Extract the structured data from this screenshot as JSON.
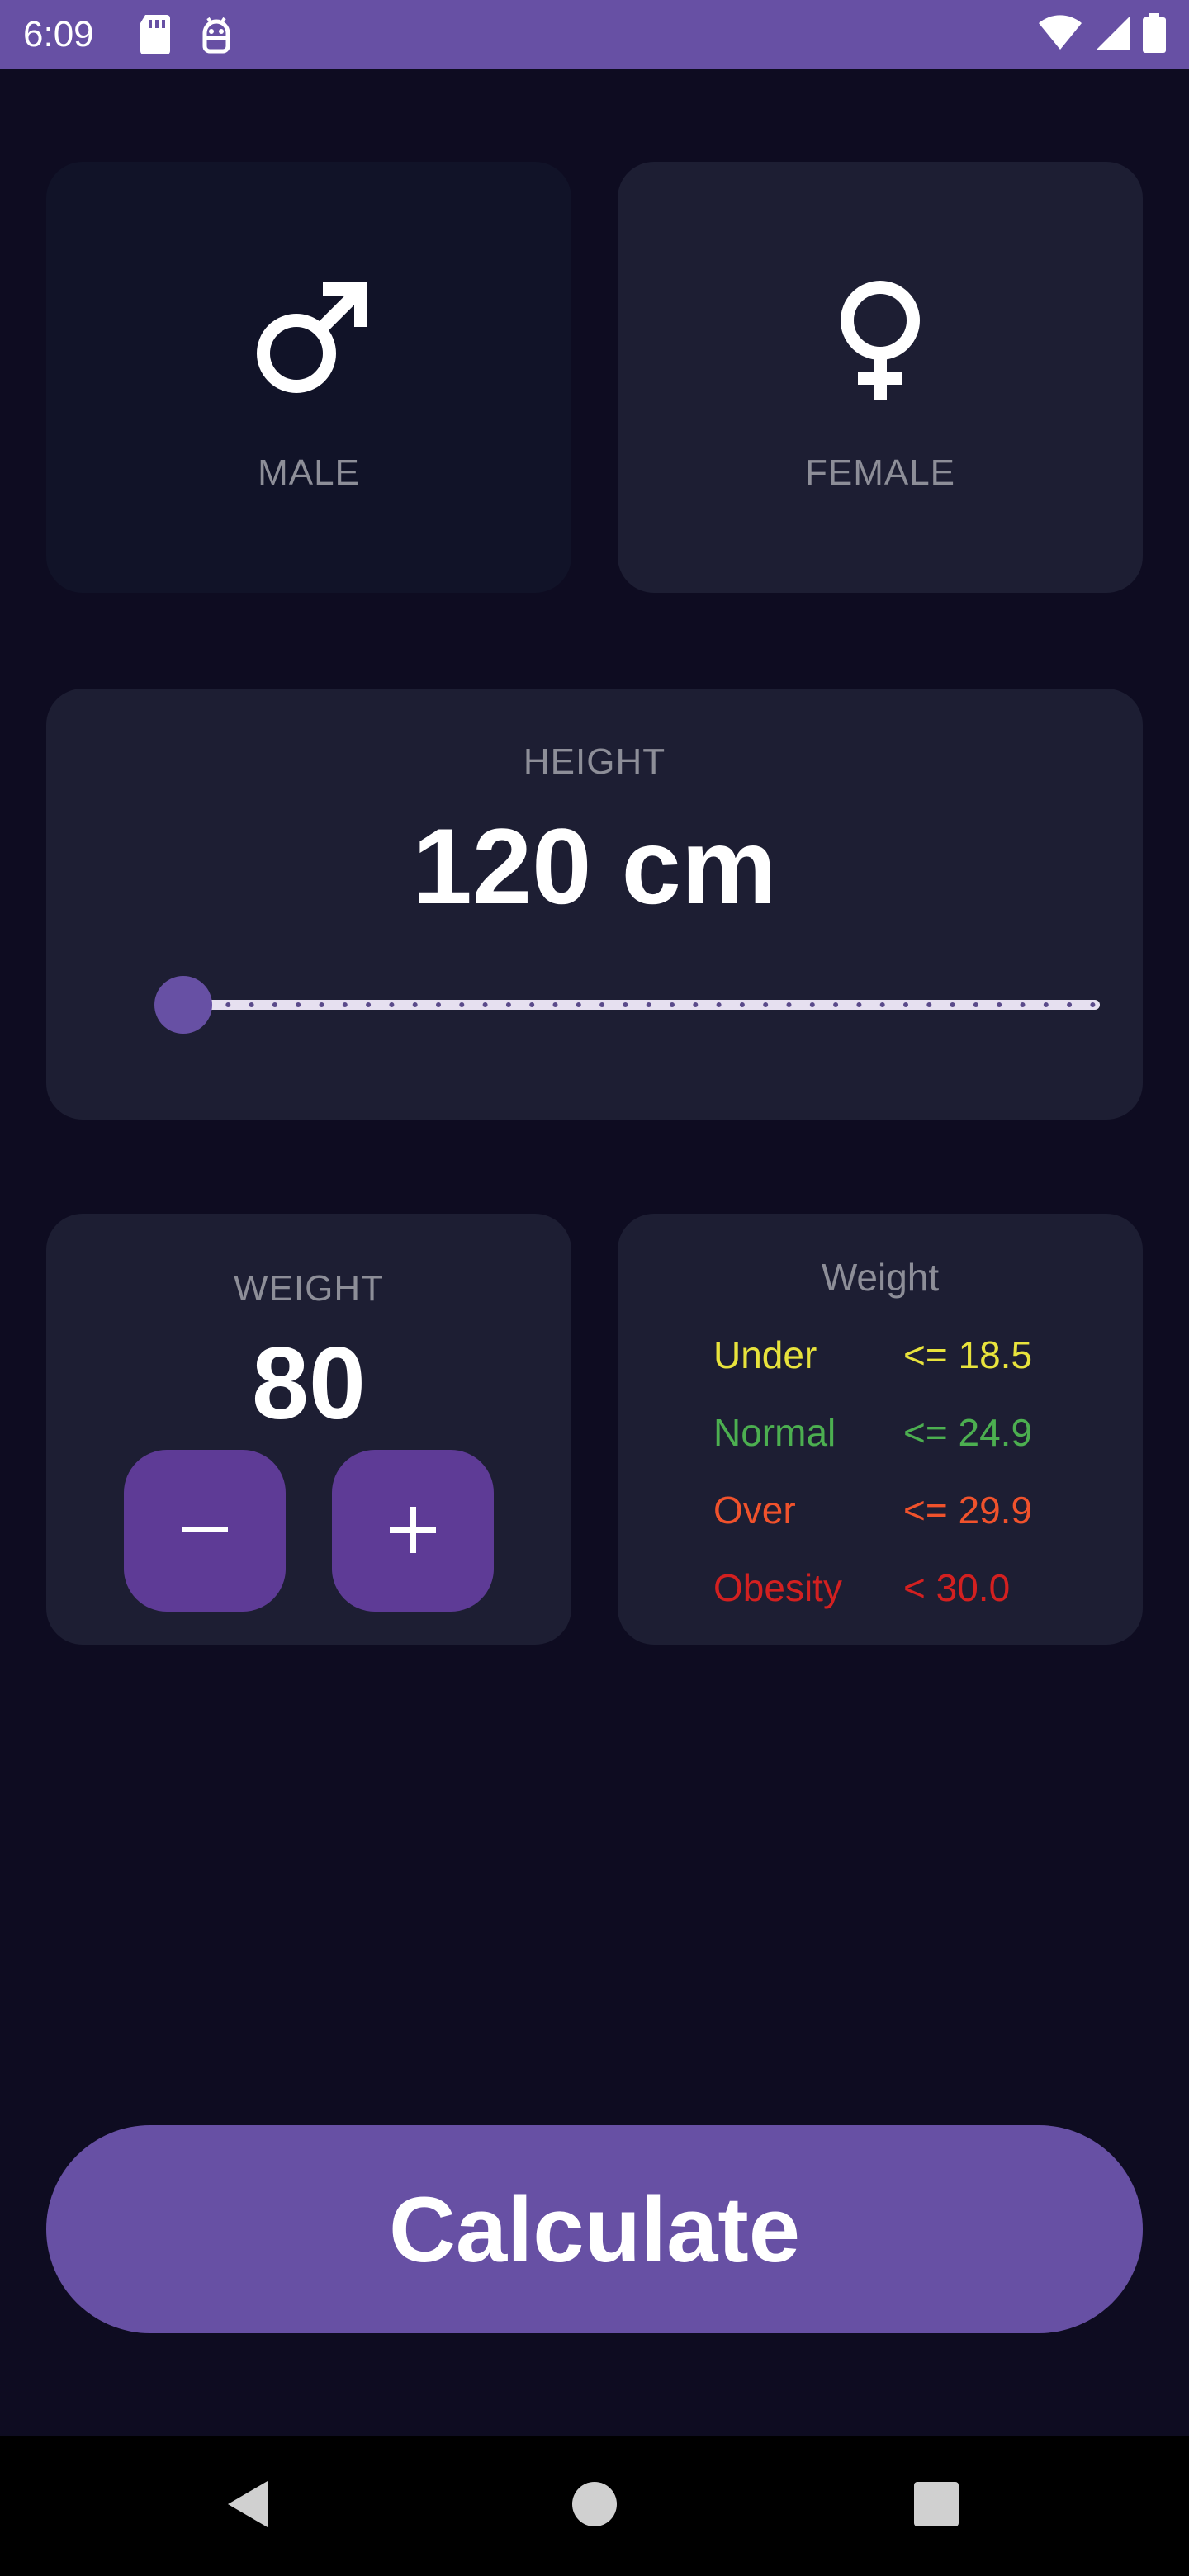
{
  "status_bar": {
    "time": "6:09",
    "left_icons": [
      "sd-card-icon",
      "android-debug-icon"
    ],
    "right_icons": [
      "wifi-icon",
      "cell-signal-icon",
      "battery-icon"
    ]
  },
  "gender": {
    "male_label": "MALE",
    "female_label": "FEMALE",
    "selected": "male"
  },
  "height": {
    "title": "HEIGHT",
    "value_text": "120 cm",
    "slider_fraction": 0.0
  },
  "weight": {
    "title": "WEIGHT",
    "value": "80",
    "minus_icon": "minus-icon",
    "plus_icon": "plus-icon"
  },
  "legend": {
    "title": "Weight",
    "rows": [
      {
        "name": "Under",
        "value": "<= 18.5",
        "color": "#e8e33c"
      },
      {
        "name": "Normal",
        "value": "<= 24.9",
        "color": "#4caf50"
      },
      {
        "name": "Over",
        "value": "<= 29.9",
        "color": "#f0522c"
      },
      {
        "name": "Obesity",
        "value": "< 30.0",
        "color": "#d32020"
      }
    ]
  },
  "calculate_label": "Calculate",
  "colors": {
    "background": "#0e0c21",
    "card": "#1d1e33",
    "card_inactive": "#111328",
    "accent": "#6750a4",
    "stepper": "#5e3b96"
  }
}
